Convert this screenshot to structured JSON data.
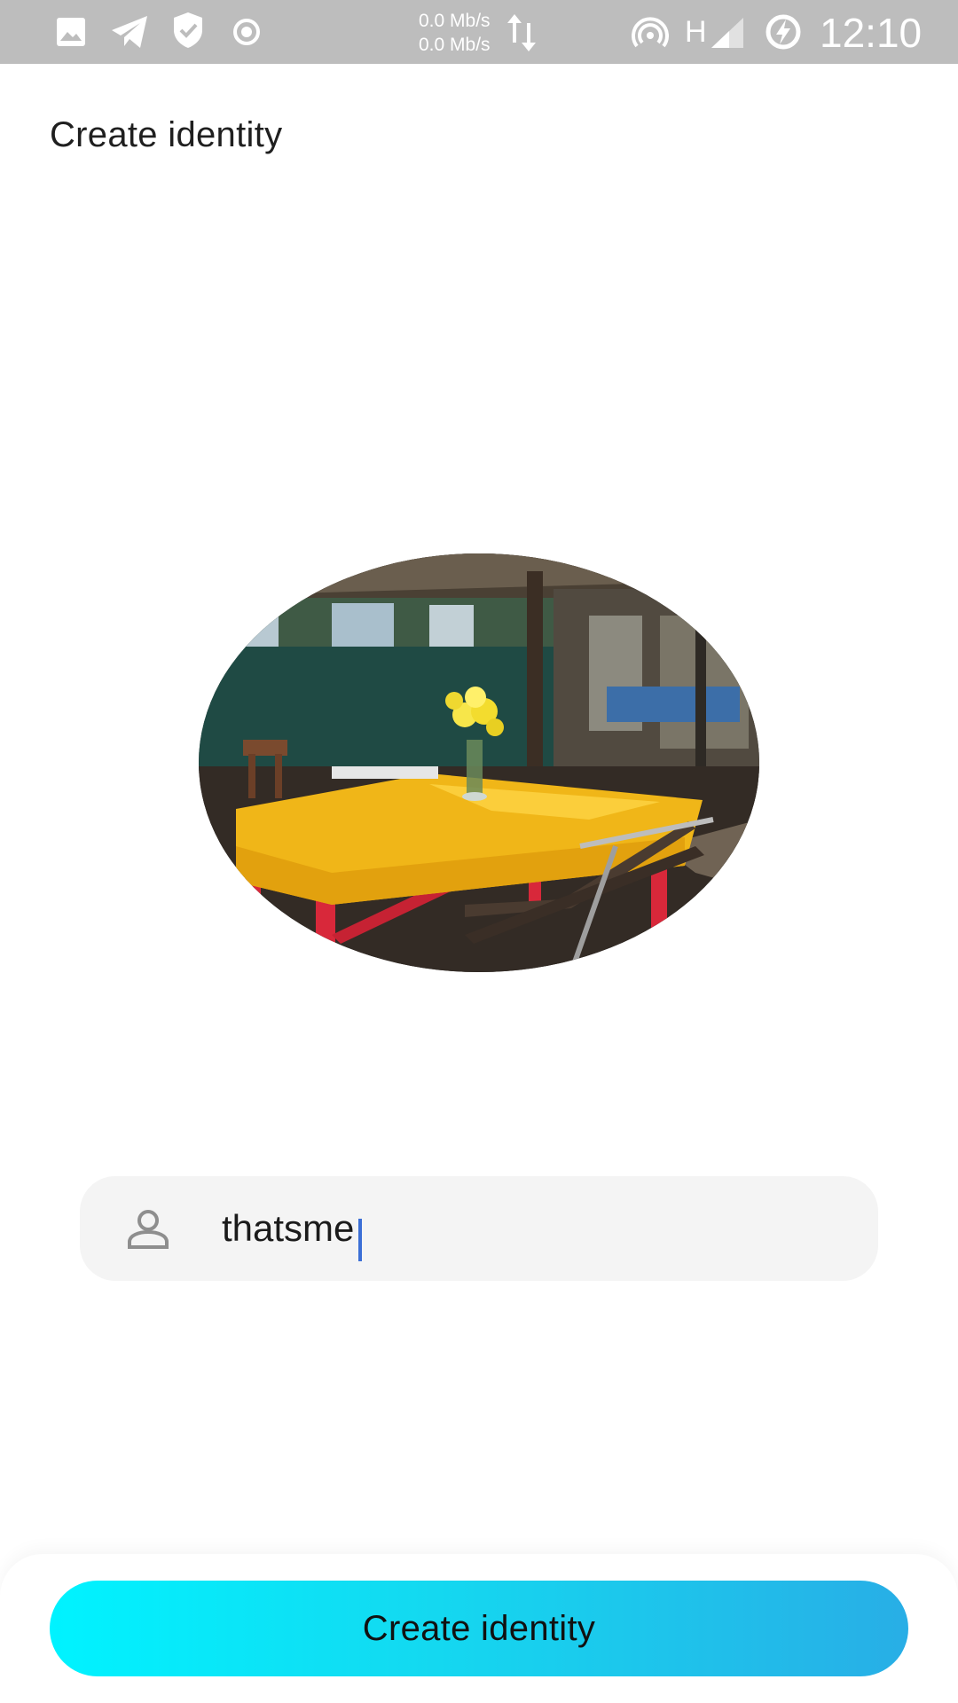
{
  "status_bar": {
    "net_speed_up": "0.0 Mb/s",
    "net_speed_down": "0.0 Mb/s",
    "network_type": "H",
    "time": "12:10",
    "icons": [
      "gallery-icon",
      "telegram-icon",
      "shield-check-icon",
      "record-icon",
      "transfer-arrows-icon",
      "hotspot-icon",
      "signal-icon",
      "battery-saver-icon"
    ]
  },
  "header": {
    "title": "Create identity"
  },
  "avatar": {
    "description_icon": "avatar-photo"
  },
  "form": {
    "name_value": "thatsme",
    "name_icon": "person-icon"
  },
  "actions": {
    "create_label": "Create identity"
  },
  "colors": {
    "status_bar_bg": "#bdbdbd",
    "field_bg": "#f4f4f4",
    "caret": "#3b6fd6",
    "button_gradient_start": "#00f3ff",
    "button_gradient_end": "#28aee6"
  }
}
